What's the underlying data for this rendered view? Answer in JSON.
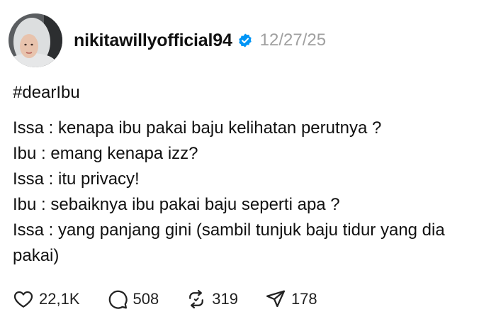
{
  "post": {
    "username": "nikitawillyofficial94",
    "date": "12/27/25",
    "hashtag": "#dearIbu",
    "lines": [
      "Issa : kenapa ibu pakai baju kelihatan perutnya ?",
      "Ibu : emang kenapa izz?",
      "Issa : itu privacy!",
      "Ibu : sebaiknya ibu pakai baju seperti apa ?",
      "Issa : yang panjang gini (sambil tunjuk baju tidur yang dia pakai)"
    ]
  },
  "actions": {
    "likes": "22,1K",
    "comments": "508",
    "reposts": "319",
    "shares": "178"
  },
  "colors": {
    "verified": "#0095f6",
    "date": "#a0a0a0",
    "text": "#111111"
  },
  "icons": [
    "heart-icon",
    "comment-icon",
    "repost-icon",
    "share-icon",
    "verified-icon"
  ]
}
